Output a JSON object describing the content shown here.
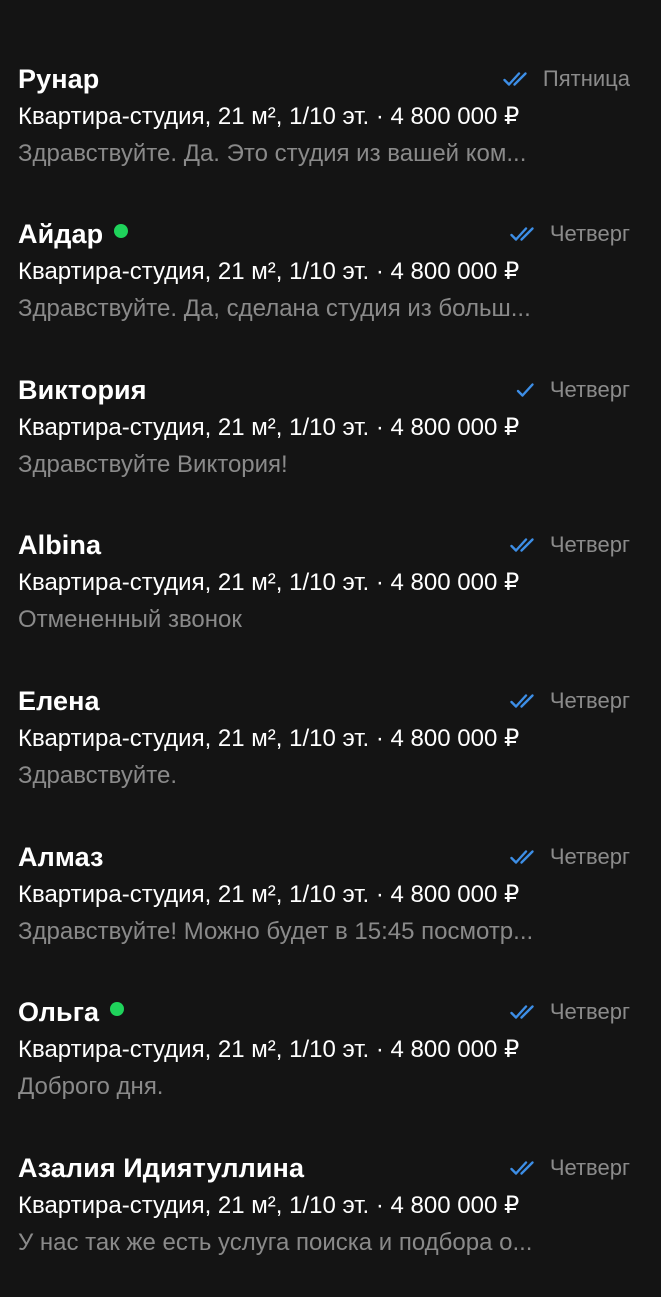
{
  "colors": {
    "background": "#141414",
    "text_primary": "#ffffff",
    "text_secondary": "#8a8a8a",
    "read_check": "#3d8ee6",
    "online_indicator": "#1fd35b"
  },
  "chats": [
    {
      "name": "Рунар",
      "online": false,
      "status": "double-check-icon",
      "date": "Пятница",
      "listing": "Квартира-студия, 21 м², 1/10 эт. · 4 800 000 ₽",
      "preview": "Здравствуйте. Да. Это студия из вашей ком..."
    },
    {
      "name": "Айдар",
      "online": true,
      "status": "double-check-icon",
      "date": "Четверг",
      "listing": "Квартира-студия, 21 м², 1/10 эт. · 4 800 000 ₽",
      "preview": "Здравствуйте. Да, сделана студия из больш..."
    },
    {
      "name": "Виктория",
      "online": false,
      "status": "single-check-icon",
      "date": "Четверг",
      "listing": "Квартира-студия, 21 м², 1/10 эт. · 4 800 000 ₽",
      "preview": "Здравствуйте Виктория!"
    },
    {
      "name": "Albina",
      "online": false,
      "status": "double-check-icon",
      "date": "Четверг",
      "listing": "Квартира-студия, 21 м², 1/10 эт. · 4 800 000 ₽",
      "preview": "Отмененный звонок"
    },
    {
      "name": "Елена",
      "online": false,
      "status": "double-check-icon",
      "date": "Четверг",
      "listing": "Квартира-студия, 21 м², 1/10 эт. · 4 800 000 ₽",
      "preview": "Здравствуйте."
    },
    {
      "name": "Алмаз",
      "online": false,
      "status": "double-check-icon",
      "date": "Четверг",
      "listing": "Квартира-студия, 21 м², 1/10 эт. · 4 800 000 ₽",
      "preview": "Здравствуйте! Можно будет в 15:45 посмотр..."
    },
    {
      "name": "Ольга",
      "online": true,
      "status": "double-check-icon",
      "date": "Четверг",
      "listing": "Квартира-студия, 21 м², 1/10 эт. · 4 800 000 ₽",
      "preview": "Доброго дня."
    },
    {
      "name": "Азалия Идиятуллина",
      "online": false,
      "status": "double-check-icon",
      "date": "Четверг",
      "listing": "Квартира-студия, 21 м², 1/10 эт. · 4 800 000 ₽",
      "preview": "У нас так же есть услуга поиска и подбора о..."
    }
  ]
}
